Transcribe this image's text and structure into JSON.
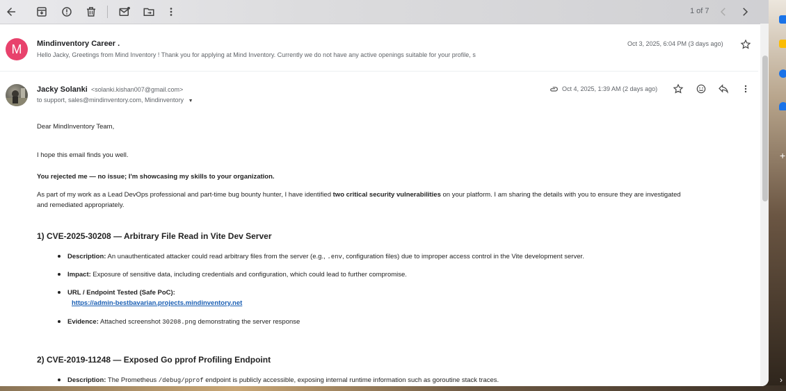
{
  "toolbar": {
    "back_label": "Back",
    "pager": "1 of 7"
  },
  "message1": {
    "avatar_letter": "M",
    "avatar_color": "#e8426c",
    "sender": "Mindinventory Career .",
    "snippet": "Hello Jacky, Greetings from Mind Inventory ! Thank you for applying at Mind Inventory. Currently we do not have any active openings suitable for your profile, s",
    "date": "Oct 3, 2025, 6:04 PM (3 days ago)"
  },
  "message2": {
    "sender": "Jacky Solanki",
    "email": "<solanki.kishan007@gmail.com>",
    "to": "to support, sales@mindinventory.com, Mindinventory",
    "date": "Oct 4, 2025, 1:39 AM (2 days ago)"
  },
  "body": {
    "greeting": "Dear MindInventory Team,",
    "intro": "I hope this email finds you well.",
    "bold_line": "You rejected me — no issue; I'm showcasing my skills to your organization.",
    "para_a": "As part of my work as a Lead DevOps professional and part-time bug bounty hunter, I have identified ",
    "para_bold": "two critical security vulnerabilities",
    "para_b": " on your platform. I am sharing the details with you to ensure they are investigated",
    "para_c": "and remediated appropriately.",
    "section1": {
      "heading": "1) CVE-2025-30208 — Arbitrary File Read in Vite Dev Server",
      "desc_label": "Description:",
      "desc_a": " An unauthenticated attacker could read arbitrary files from the server (e.g., ",
      "desc_code": ".env",
      "desc_b": ", configuration files) due to improper access control in the Vite development server.",
      "impact_label": "Impact:",
      "impact_text": " Exposure of sensitive data, including credentials and configuration, which could lead to further compromise.",
      "url_label": "URL / Endpoint Tested (Safe PoC):",
      "url": "https://admin-bestbavarian.projects.mindinventory.net",
      "evidence_label": "Evidence:",
      "evidence_a": " Attached screenshot ",
      "evidence_code": "30208.png",
      "evidence_b": " demonstrating the server response"
    },
    "section2": {
      "heading": "2) CVE-2019-11248 — Exposed Go pprof Profiling Endpoint",
      "desc_label": "Description:",
      "desc_a": " The Prometheus ",
      "desc_code": "/debug/pprof",
      "desc_b": " endpoint is publicly accessible, exposing internal runtime information such as goroutine stack traces."
    }
  }
}
